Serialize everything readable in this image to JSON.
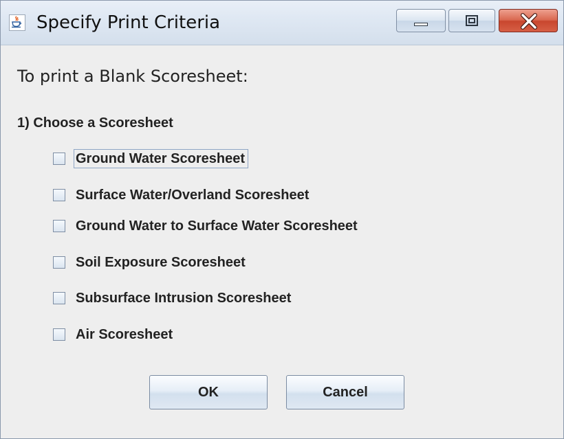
{
  "window": {
    "title": "Specify Print Criteria",
    "controls": [
      "minimize",
      "maximize",
      "close"
    ]
  },
  "heading": "To print a Blank Scoresheet:",
  "step": {
    "label": "1) Choose a Scoresheet",
    "options": [
      {
        "label": "Ground Water Scoresheet",
        "checked": false,
        "focused": true
      },
      {
        "label": "Surface Water/Overland Scoresheet",
        "checked": false,
        "focused": false
      },
      {
        "label": "Ground Water to Surface Water Scoresheet",
        "checked": false,
        "focused": false
      },
      {
        "label": "Soil Exposure Scoresheet",
        "checked": false,
        "focused": false
      },
      {
        "label": "Subsurface Intrusion Scoresheet",
        "checked": false,
        "focused": false
      },
      {
        "label": "Air Scoresheet",
        "checked": false,
        "focused": false
      }
    ]
  },
  "buttons": {
    "ok": "OK",
    "cancel": "Cancel"
  },
  "icons": {
    "app": "java-cup-icon",
    "minimize": "minimize-icon",
    "maximize": "maximize-icon",
    "close": "close-icon"
  },
  "colors": {
    "close_button": "#c8462e",
    "titlebar": "#dfe8f3",
    "background": "#eeeeee"
  }
}
